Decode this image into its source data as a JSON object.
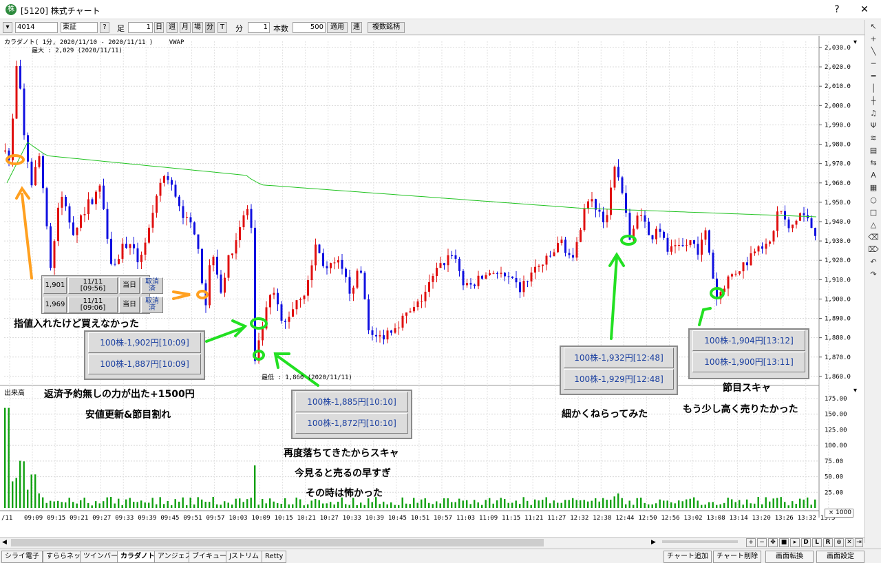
{
  "window": {
    "title": "[5120] 株式チャート",
    "help": "?"
  },
  "toolbar": {
    "code": "4014",
    "market": "東証",
    "help": "?",
    "label_ashi": "足",
    "ashi_value": "1",
    "btn_day": "日",
    "btn_week": "週",
    "btn_month": "月",
    "btn_ba": "場",
    "btn_fun_active": "分",
    "btn_t": "T",
    "label_fun": "分",
    "fun_value": "1",
    "label_count": "本数",
    "count_value": "500",
    "apply": "適用",
    "ren": "連",
    "multi": "複数銘柄"
  },
  "chart_header": {
    "title": "カラダノト( 1分, 2020/11/10 - 2020/11/11 )",
    "indicator": "VWAP",
    "max_label": "最大 : 2,029 (2020/11/11)",
    "min_label": "最低 : 1,860 (2020/11/11)",
    "volume_label": "出来高",
    "volume_scale": "× 1000"
  },
  "chart_data": {
    "type": "candlestick",
    "price_axis": [
      "2,030.0",
      "2,020.0",
      "2,010.0",
      "2,000.0",
      "1,990.0",
      "1,980.0",
      "1,970.0",
      "1,960.0",
      "1,950.0",
      "1,940.0",
      "1,930.0",
      "1,920.0",
      "1,910.0",
      "1,900.0",
      "1,890.0",
      "1,880.0",
      "1,870.0",
      "1,860.0"
    ],
    "volume_axis": [
      "175.00",
      "150.00",
      "125.00",
      "100.00",
      "75.00",
      "50.00",
      "25.00"
    ],
    "time_axis": [
      "/11",
      "09:09",
      "09:15",
      "09:21",
      "09:27",
      "09:33",
      "09:39",
      "09:45",
      "09:51",
      "09:57",
      "10:03",
      "10:09",
      "10:15",
      "10:21",
      "10:27",
      "10:33",
      "10:39",
      "10:45",
      "10:51",
      "10:57",
      "11:03",
      "11:09",
      "11:15",
      "11:21",
      "11:27",
      "12:32",
      "12:38",
      "12:44",
      "12:50",
      "12:56",
      "13:02",
      "13:08",
      "13:14",
      "13:20",
      "13:26",
      "13:32",
      "13:3"
    ],
    "ylim": [
      1855,
      2035
    ],
    "max_price": 2029,
    "min_price": 1860
  },
  "orders": [
    {
      "price": "1,901",
      "date": "11/11",
      "time": "[09:56]",
      "type": "当日",
      "status_1": "取消",
      "status_2": "済"
    },
    {
      "price": "1,969",
      "date": "11/11",
      "time": "[09:06]",
      "type": "当日",
      "status_1": "取消",
      "status_2": "済"
    }
  ],
  "trades": {
    "t1": [
      "100株-1,902円[10:09]",
      "100株-1,887円[10:09]"
    ],
    "t2": [
      "100株-1,885円[10:10]",
      "100株-1,872円[10:10]"
    ],
    "t3": [
      "100株-1,932円[12:48]",
      "100株-1,929円[12:48]"
    ],
    "t4": [
      "100株-1,904円[13:12]",
      "100株-1,900円[13:11]"
    ]
  },
  "annotations": {
    "a1": "指値入れたけど買えなかった",
    "a2": "返済予約無しの力が出た+1500円",
    "a3": "安値更新&節目割れ",
    "a4": "再度落ちてきたからスキャ",
    "a5": "今見ると売るの早すぎ",
    "a6": "その時は怖かった",
    "a7": "細かくねらってみた",
    "a8": "節目スキャ",
    "a9": "もう少し高く売りたかった"
  },
  "bottom_nav": {
    "d": "D",
    "l": "L",
    "r": "R",
    "x": "✕"
  },
  "tabs": [
    "シライ電子",
    "すららネット",
    "ツインバード",
    "カラダノト",
    "アンジェス",
    "ブイキューブ",
    "Jストリム",
    "Retty"
  ],
  "active_tab": "カラダノト",
  "bottom_buttons": [
    "チャート追加",
    "チャート削除",
    "画面転換",
    "画面設定"
  ],
  "colors": {
    "up": "#e01010",
    "down": "#1010e0",
    "vwap": "#22c322",
    "volume": "#10a010",
    "annotation_green": "#22e022",
    "annotation_orange": "#ffa020"
  }
}
